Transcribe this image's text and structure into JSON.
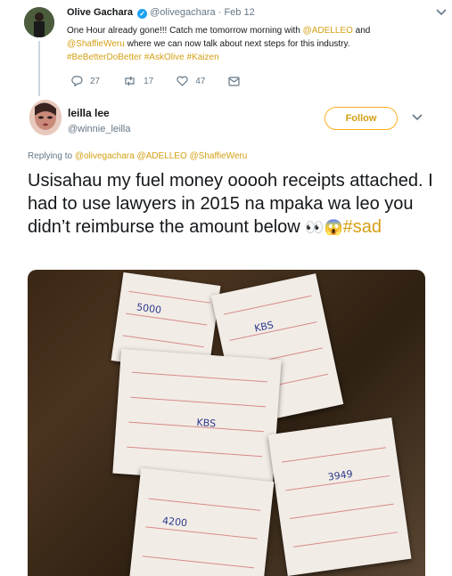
{
  "parent": {
    "name": "Olive Gachara",
    "handle": "@olivegachara",
    "date": "· Feb 12",
    "text_start": "One Hour already gone!!! Catch me tomorrow morning with ",
    "mention_1": "@ADELLEO",
    "text_mid": " and",
    "mention_2": "@ShaffieWeru",
    "text_end": " where we can now talk about next steps for this industry.",
    "hashtags": "#BeBetterDoBetter #AskOlive #Kaizen",
    "reply_count": "27",
    "retweet_count": "17",
    "like_count": "47"
  },
  "reply": {
    "name": "leilla lee",
    "handle": "@winnie_leilla",
    "follow_label": "Follow",
    "replying_label": "Replying to ",
    "replying_to": "@olivegachara @ADELLEO @ShaffieWeru",
    "text": "Usisahau  my fuel money ooooh receipts attached. I had to use lawyers in 2015 na mpaka wa leo you didn’t reimburse the amount below ",
    "emoji": "👀😱",
    "hashtag": "#sad"
  },
  "colors": {
    "accent": "#d4a015",
    "follow_border": "#ffad1f",
    "verified": "#1da1f2",
    "muted": "#657786"
  },
  "icons": [
    "verified-badge-icon",
    "chevron-down-icon",
    "reply-icon",
    "retweet-icon",
    "like-icon",
    "message-icon"
  ]
}
